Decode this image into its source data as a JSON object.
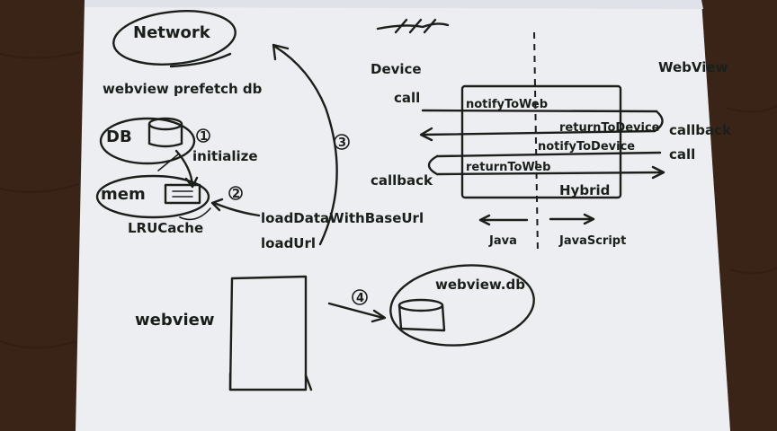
{
  "colors": {
    "table": "#3a2418",
    "paper": "#eceef2",
    "ink": "#1b1f1a"
  },
  "labels": {
    "network": "Network",
    "prefetch_db": "webview prefetch db",
    "db": "DB",
    "step1": "1",
    "initialize": "initialize",
    "mem": "mem",
    "step2": "2",
    "lrucache": "LRUCache",
    "load_data": "loadDataWithBaseUrl",
    "load_url": "loadUrl",
    "step3": "3",
    "device": "Device",
    "webview_top": "WebView",
    "call_left": "call",
    "notify_to_web": "notifyToWeb",
    "return_to_device": "returnToDevice",
    "callback_right": "callback",
    "notify_to_device": "notifyToDevice",
    "call_right": "call",
    "callback_left": "callback",
    "return_to_web": "returnToWeb",
    "hybrid": "Hybrid",
    "java": "Java",
    "javascript": "JavaScript",
    "webview_bottom": "webview",
    "step4": "4",
    "webview_db": "webview.db"
  }
}
